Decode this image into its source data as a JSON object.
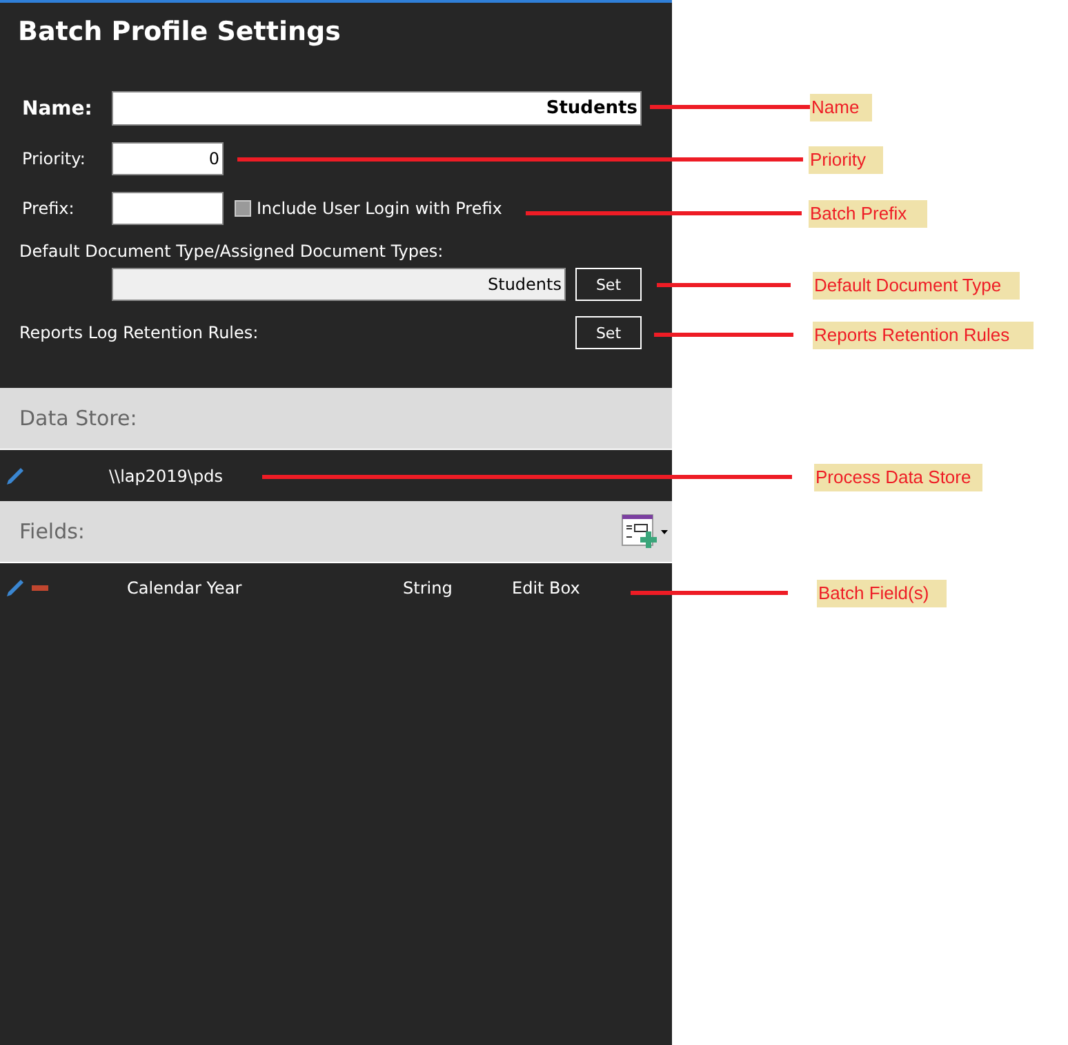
{
  "title": "Batch Profile Settings",
  "name": {
    "label": "Name:",
    "value": "Students"
  },
  "priority": {
    "label": "Priority:",
    "value": "0"
  },
  "prefix": {
    "label": "Prefix:",
    "checkbox": {
      "label": "Include User Login with Prefix",
      "checked": false
    }
  },
  "document_types": {
    "label": "Default Document Type/Assigned Document Types:",
    "value": "Students",
    "button": "Set"
  },
  "retention": {
    "label": "Reports Log Retention Rules:",
    "button": "Set"
  },
  "data_store": {
    "header": "Data Store:",
    "path": "\\\\lap2019\\pds"
  },
  "fields": {
    "header": "Fields:",
    "rows": [
      {
        "name": "Calendar Year",
        "type": "String",
        "control": "Edit Box"
      }
    ]
  },
  "annotations": [
    {
      "label": "Name"
    },
    {
      "label": "Priority"
    },
    {
      "label": "Batch Prefix"
    },
    {
      "label": "Default Document Type"
    },
    {
      "label": "Reports Retention Rules"
    },
    {
      "label": "Process Data Store"
    },
    {
      "label": "Batch Field(s)"
    }
  ]
}
